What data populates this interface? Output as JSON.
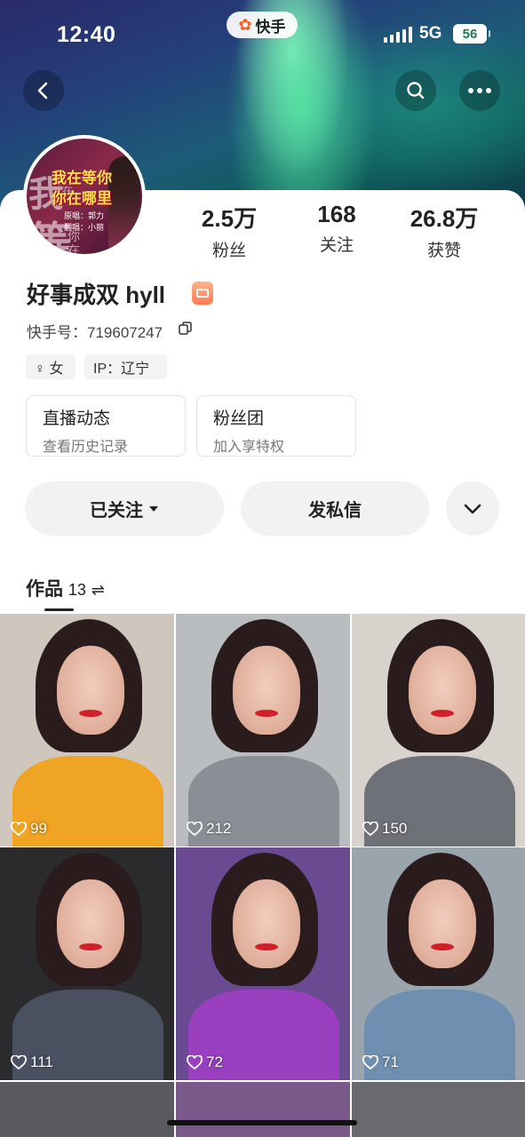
{
  "status_bar": {
    "time": "12:40",
    "app_name": "快手",
    "network": "5G",
    "battery": "56"
  },
  "header": {
    "back_icon": "chevron-left-icon",
    "search_icon": "search-icon",
    "more_icon": "more-horizontal-icon"
  },
  "avatar": {
    "line1": "我在等你",
    "line2": "你在哪里",
    "credit1": "原唱：郭力",
    "credit2": "翻唱：小丽",
    "side_chars": [
      "我",
      "在",
      "等",
      "你",
      "在"
    ]
  },
  "stats": [
    {
      "value": "2.5万",
      "label": "粉丝"
    },
    {
      "value": "168",
      "label": "关注"
    },
    {
      "value": "26.8万",
      "label": "获赞"
    }
  ],
  "profile": {
    "username": "好事成双 hyll",
    "kuaishou_id": "快手号：719607247",
    "tags": [
      {
        "icon": "female-icon",
        "label": "♀ 女"
      },
      {
        "label": "IP：辽宁"
      }
    ]
  },
  "entries": [
    {
      "title": "直播动态",
      "subtitle": "查看历史记录"
    },
    {
      "title": "粉丝团",
      "subtitle": "加入享特权"
    }
  ],
  "actions": {
    "following": "已关注",
    "message": "发私信"
  },
  "works": {
    "label": "作品",
    "count": "13",
    "sort_icon": "⇌"
  },
  "grid": [
    {
      "likes": "99",
      "top_color": "#f0a423",
      "bg": "#cfc6bd"
    },
    {
      "likes": "212",
      "top_color": "#8a8f96",
      "bg": "#b9bdc0"
    },
    {
      "likes": "150",
      "top_color": "#6e7278",
      "bg": "#d8d2cc"
    },
    {
      "likes": "111",
      "top_color": "#4a5060",
      "bg": "#2b2b2e"
    },
    {
      "likes": "72",
      "top_color": "#9a3fc0",
      "bg": "#6a4a90"
    },
    {
      "likes": "71",
      "top_color": "#6f8fb0",
      "bg": "#9aa4ad"
    }
  ]
}
